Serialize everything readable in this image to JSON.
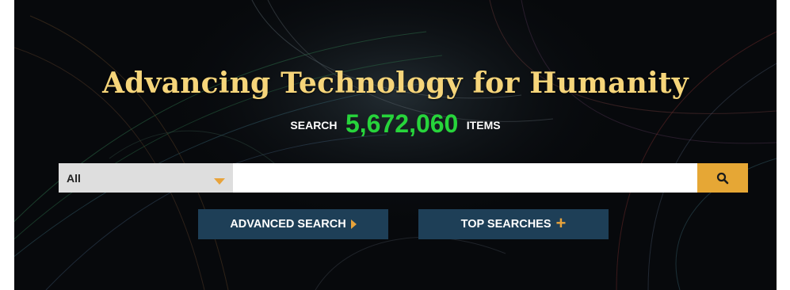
{
  "hero": {
    "title": "Advancing Technology for Humanity",
    "count_prefix": "SEARCH",
    "count_value": "5,672,060",
    "count_suffix": "ITEMS"
  },
  "search": {
    "scope_value": "All",
    "query_value": "",
    "submit_icon": "search-icon"
  },
  "actions": {
    "advanced_label": "ADVANCED SEARCH",
    "advanced_icon": "triangle-right-icon",
    "top_label": "TOP SEARCHES",
    "top_icon": "plus-icon"
  },
  "colors": {
    "title": "#f6d57a",
    "count": "#27d43b",
    "accent": "#e6a735",
    "button_bg": "#1e3f57",
    "hero_bg": "#07090c"
  }
}
